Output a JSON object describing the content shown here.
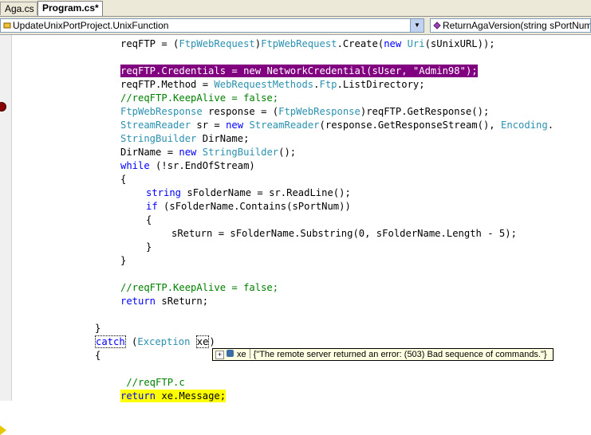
{
  "tabs": [
    {
      "label": "Aga.cs",
      "active": false
    },
    {
      "label": "Program.cs*",
      "active": true
    }
  ],
  "nav": {
    "class_combo": "UpdateUnixPortProject.UnixFunction",
    "member_combo": "ReturnAgaVersion(string sPortNum, st"
  },
  "code": {
    "l1a": "reqFTP = (",
    "l1b": "FtpWebRequest",
    "l1c": ")",
    "l1d": "FtpWebRequest",
    "l1e": ".Create(",
    "l1f": "new",
    "l1g": " ",
    "l1h": "Uri",
    "l1i": "(sUnixURL));",
    "l2a": "reqFTP.Credentials = ",
    "l2b": "new",
    "l2c": " NetworkCredential(sUser, ",
    "l2d": "\"Admin98\"",
    "l2e": ");",
    "l3a": "reqFTP.Method = ",
    "l3b": "WebRequestMethods",
    "l3c": ".",
    "l3d": "Ftp",
    "l3e": ".ListDirectory;",
    "l4": "//reqFTP.KeepAlive = false;",
    "l5a": "FtpWebResponse",
    "l5b": " response = (",
    "l5c": "FtpWebResponse",
    "l5d": ")reqFTP.GetResponse();",
    "l6a": "StreamReader",
    "l6b": " sr = ",
    "l6c": "new",
    "l6d": " ",
    "l6e": "StreamReader",
    "l6f": "(response.GetResponseStream(), ",
    "l6g": "Encoding",
    "l6h": ".",
    "l7a": "StringBuilder",
    "l7b": " DirName;",
    "l8a": "DirName = ",
    "l8b": "new",
    "l8c": " ",
    "l8d": "StringBuilder",
    "l8e": "();",
    "l9a": "while",
    "l9b": " (!sr.EndOfStream)",
    "l10": "{",
    "l11a": "string",
    "l11b": " sFolderName = sr.ReadLine();",
    "l12a": "if",
    "l12b": " (sFolderName.Contains(sPortNum))",
    "l13": "{",
    "l14": "sReturn = sFolderName.Substring(0, sFolderName.Length - 5);",
    "l15": "}",
    "l16": "}",
    "l17": "//reqFTP.KeepAlive = false;",
    "l18a": "return",
    "l18b": " sReturn;",
    "l19": "}",
    "l20a": "catch",
    "l20b": " (",
    "l20c": "Exception",
    "l20d": " ",
    "l20e": "xe",
    "l20f": ")",
    "l21": "{",
    "l22": " //reqFTP.c",
    "l23a": "return",
    "l23b": " xe.Message;"
  },
  "tooltip": {
    "expand": "+",
    "var": "xe",
    "value": "{\"The remote server returned an error: (503) Bad sequence of commands.\"}"
  },
  "colors": {
    "keyword": "#0000ff",
    "type": "#2b91af",
    "comment": "#008000",
    "string": "#a31515",
    "breakpoint_highlight": "#800080",
    "current_statement": "#ffff00"
  }
}
